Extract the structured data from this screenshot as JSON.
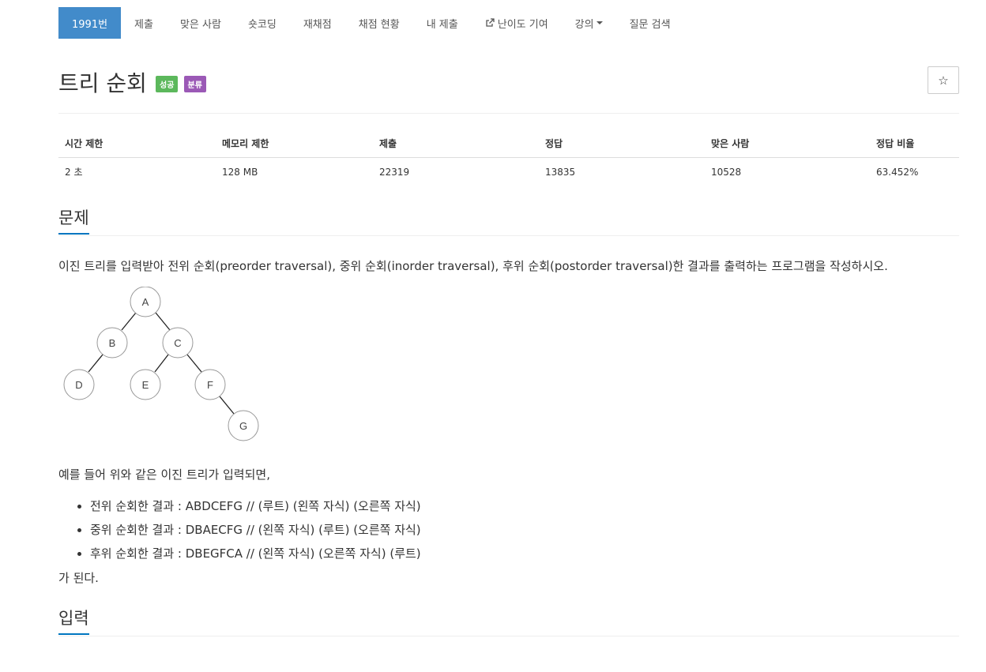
{
  "nav": {
    "items": [
      {
        "label": "1991번",
        "active": true
      },
      {
        "label": "제출"
      },
      {
        "label": "맞은 사람"
      },
      {
        "label": "숏코딩"
      },
      {
        "label": "재채점"
      },
      {
        "label": "채점 현황"
      },
      {
        "label": "내 제출"
      },
      {
        "label": "난이도 기여",
        "icon": "external-link-icon"
      },
      {
        "label": "강의",
        "dropdown": true
      },
      {
        "label": "질문 검색"
      }
    ]
  },
  "problem": {
    "title": "트리 순회",
    "badges": {
      "status": "성공",
      "tag": "분류"
    },
    "star_icon": "☆"
  },
  "stats": {
    "headers": [
      "시간 제한",
      "메모리 제한",
      "제출",
      "정답",
      "맞은 사람",
      "정답 비율"
    ],
    "values": [
      "2 초",
      "128 MB",
      "22319",
      "13835",
      "10528",
      "63.452%"
    ]
  },
  "sections": {
    "problem_title": "문제",
    "input_title": "입력"
  },
  "description": "이진 트리를 입력받아 전위 순회(preorder traversal), 중위 순회(inorder traversal), 후위 순회(postorder traversal)한 결과를 출력하는 프로그램을 작성하시오.",
  "tree": {
    "nodes": [
      "A",
      "B",
      "C",
      "D",
      "E",
      "F",
      "G"
    ]
  },
  "example_intro": "예를 들어 위와 같은 이진 트리가 입력되면,",
  "results": [
    "전위 순회한 결과 : ABDCEFG // (루트) (왼쪽 자식) (오른쪽 자식)",
    "중위 순회한 결과 : DBAECFG // (왼쪽 자식) (루트) (오른쪽 자식)",
    "후위 순회한 결과 : DBEGFCA // (왼쪽 자식) (오른쪽 자식) (루트)"
  ],
  "ending": "가 된다."
}
